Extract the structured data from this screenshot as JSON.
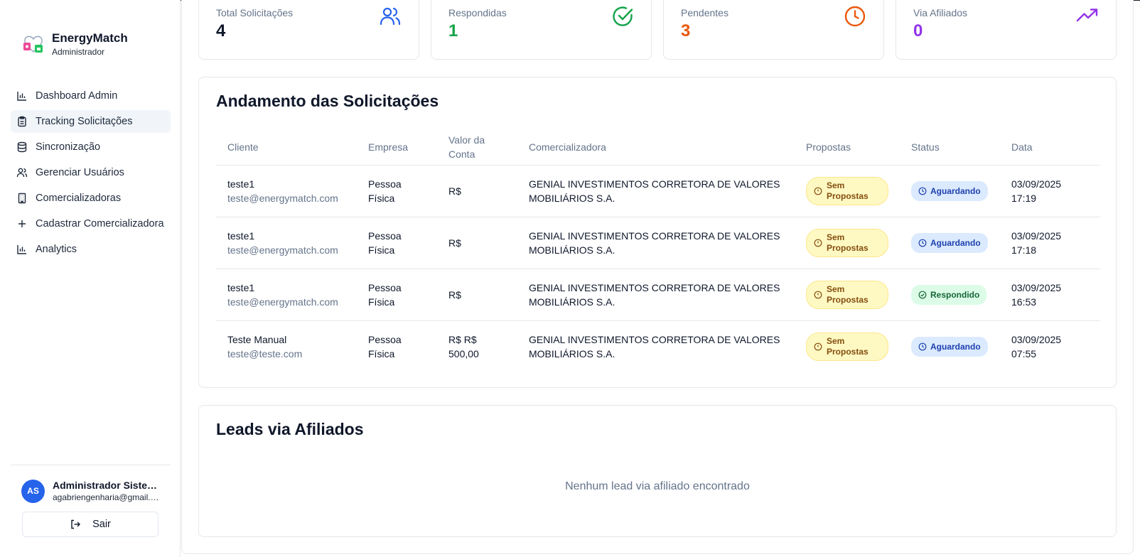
{
  "brand": {
    "title": "EnergyMatch",
    "subtitle": "Administrador",
    "logo_icon": "energymatch-logo"
  },
  "sidebar": {
    "items": [
      {
        "label": "Dashboard Admin",
        "icon": "bar-chart-icon",
        "active": false
      },
      {
        "label": "Tracking Solicitações",
        "icon": "clipboard-icon",
        "active": true
      },
      {
        "label": "Sincronização",
        "icon": "database-icon",
        "active": false
      },
      {
        "label": "Gerenciar Usuários",
        "icon": "users-icon",
        "active": false
      },
      {
        "label": "Comercializadoras",
        "icon": "building-icon",
        "active": false
      },
      {
        "label": "Cadastrar Comercializadora",
        "icon": "plus-icon",
        "active": false
      },
      {
        "label": "Analytics",
        "icon": "bar-chart-icon",
        "active": false
      }
    ]
  },
  "user": {
    "initials": "AS",
    "name": "Administrador Sistema",
    "email": "agabriengenharia@gmail.com",
    "logout_label": "Sair"
  },
  "stats": [
    {
      "label": "Total Solicitações",
      "value": "4",
      "color": "#0f172a",
      "icon": "users-icon",
      "icon_color": "#2563eb"
    },
    {
      "label": "Respondidas",
      "value": "1",
      "color": "#16a34a",
      "icon": "check-circle-icon",
      "icon_color": "#16a34a"
    },
    {
      "label": "Pendentes",
      "value": "3",
      "color": "#ea580c",
      "icon": "clock-icon",
      "icon_color": "#ea580c"
    },
    {
      "label": "Via Afiliados",
      "value": "0",
      "color": "#9333ea",
      "icon": "trending-up-icon",
      "icon_color": "#9333ea"
    }
  ],
  "tracking": {
    "title": "Andamento das Solicitações",
    "columns": [
      "Cliente",
      "Empresa",
      "Valor da Conta",
      "Comercializadora",
      "Propostas",
      "Status",
      "Data"
    ],
    "rows": [
      {
        "name": "teste1",
        "email": "teste@energymatch.com",
        "empresa": "Pessoa Física",
        "valor": "R$",
        "comercializadora": "GENIAL INVESTIMENTOS CORRETORA DE VALORES MOBILIÁRIOS S.A.",
        "propostas": "Sem Propostas",
        "status": "Aguardando",
        "status_type": "waiting",
        "date": "03/09/2025",
        "time": "17:19"
      },
      {
        "name": "teste1",
        "email": "teste@energymatch.com",
        "empresa": "Pessoa Física",
        "valor": "R$",
        "comercializadora": "GENIAL INVESTIMENTOS CORRETORA DE VALORES MOBILIÁRIOS S.A.",
        "propostas": "Sem Propostas",
        "status": "Aguardando",
        "status_type": "waiting",
        "date": "03/09/2025",
        "time": "17:18"
      },
      {
        "name": "teste1",
        "email": "teste@energymatch.com",
        "empresa": "Pessoa Física",
        "valor": "R$",
        "comercializadora": "GENIAL INVESTIMENTOS CORRETORA DE VALORES MOBILIÁRIOS S.A.",
        "propostas": "Sem Propostas",
        "status": "Respondido",
        "status_type": "answered",
        "date": "03/09/2025",
        "time": "16:53"
      },
      {
        "name": "Teste Manual",
        "email": "teste@teste.com",
        "empresa": "Pessoa Física",
        "valor": "R$ R$ 500,00",
        "comercializadora": "GENIAL INVESTIMENTOS CORRETORA DE VALORES MOBILIÁRIOS S.A.",
        "propostas": "Sem Propostas",
        "status": "Aguardando",
        "status_type": "waiting",
        "date": "03/09/2025",
        "time": "07:55"
      }
    ]
  },
  "affiliates": {
    "title": "Leads via Afiliados",
    "empty_message": "Nenhum lead via afiliado encontrado"
  }
}
